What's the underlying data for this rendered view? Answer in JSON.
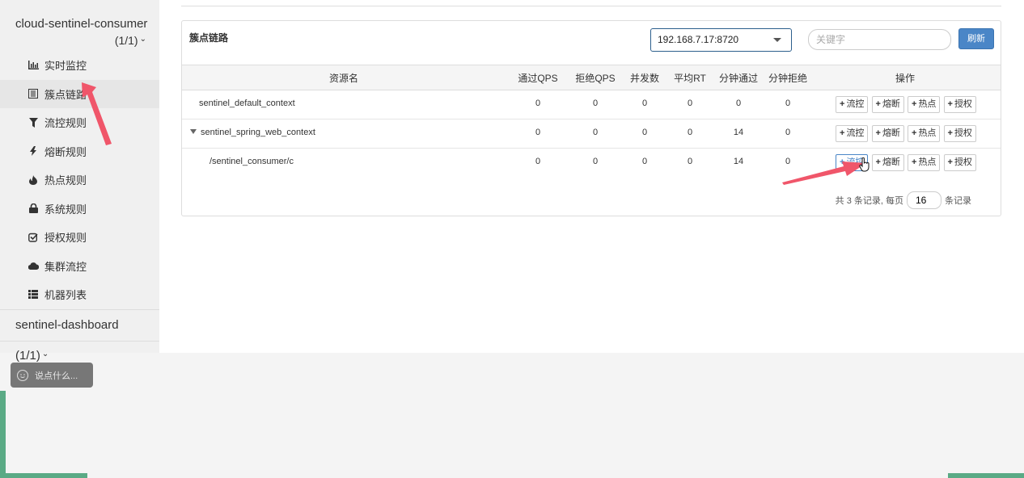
{
  "sidebar": {
    "app_name": "cloud-sentinel-consumer",
    "app_count": "(1/1)",
    "items": [
      {
        "label": "实时监控",
        "icon": "bar-chart-icon"
      },
      {
        "label": "簇点链路",
        "icon": "list-icon",
        "active": true
      },
      {
        "label": "流控规则",
        "icon": "filter-icon"
      },
      {
        "label": "熔断规则",
        "icon": "flash-icon"
      },
      {
        "label": "热点规则",
        "icon": "fire-icon"
      },
      {
        "label": "系统规则",
        "icon": "lock-icon"
      },
      {
        "label": "授权规则",
        "icon": "check-square-icon"
      },
      {
        "label": "集群流控",
        "icon": "cloud-icon"
      },
      {
        "label": "机器列表",
        "icon": "th-list-icon"
      }
    ],
    "app2_name": "sentinel-dashboard (1/1)"
  },
  "panel": {
    "title": "簇点链路",
    "machine": "192.168.7.17:8720",
    "search_placeholder": "关键字",
    "refresh_label": "刷新"
  },
  "table": {
    "headers": [
      "资源名",
      "通过QPS",
      "拒绝QPS",
      "并发数",
      "平均RT",
      "分钟通过",
      "分钟拒绝",
      "操作"
    ],
    "rows": [
      {
        "name": "sentinel_default_context",
        "pass_qps": "0",
        "block_qps": "0",
        "concurrency": "0",
        "avg_rt": "0",
        "minute_pass": "0",
        "minute_block": "0"
      },
      {
        "name": "sentinel_spring_web_context",
        "pass_qps": "0",
        "block_qps": "0",
        "concurrency": "0",
        "avg_rt": "0",
        "minute_pass": "14",
        "minute_block": "0"
      },
      {
        "name": "/sentinel_consumer/c",
        "pass_qps": "0",
        "block_qps": "0",
        "concurrency": "0",
        "avg_rt": "0",
        "minute_pass": "14",
        "minute_block": "0"
      }
    ],
    "ops": {
      "flow": "流控",
      "degrade": "熔断",
      "param": "热点",
      "authority": "授权"
    }
  },
  "pager": {
    "summary": "共 3 条记录, 每页",
    "page_size": "16",
    "suffix": "条记录"
  },
  "chat": {
    "placeholder": "说点什么..."
  },
  "colors": {
    "accent": "#4a86c7",
    "arrow": "#f0566a",
    "green": "#5aaa85"
  }
}
